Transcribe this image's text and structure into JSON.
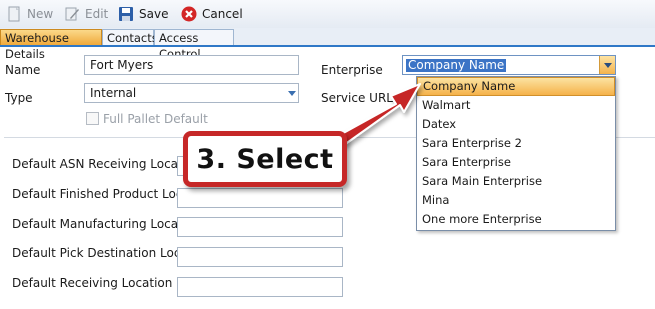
{
  "toolbar": {
    "new_label": "New",
    "edit_label": "Edit",
    "save_label": "Save",
    "cancel_label": "Cancel"
  },
  "tabs": [
    {
      "label": "Warehouse Details",
      "active": true
    },
    {
      "label": "Contacts",
      "active": false
    },
    {
      "label": "Access Control",
      "active": false
    }
  ],
  "form": {
    "name_label": "Name",
    "name_value": "Fort Myers",
    "type_label": "Type",
    "type_value": "Internal",
    "full_pallet_label": "Full Pallet Default",
    "enterprise_label": "Enterprise",
    "enterprise_value": "Company Name",
    "service_url_label": "Service URL"
  },
  "locations": [
    {
      "label": "Default ASN Receiving Location",
      "value": ""
    },
    {
      "label": "Default Finished Product Location",
      "value": ""
    },
    {
      "label": "Default Manufacturing Location",
      "value": ""
    },
    {
      "label": "Default Pick Destination Location",
      "value": ""
    },
    {
      "label": "Default Receiving Location",
      "value": ""
    }
  ],
  "enterprise_options": [
    "Company Name",
    "Walmart",
    "Datex",
    "Sara Enterprise  2",
    "Sara Enterprise",
    "Sara Main Enterprise",
    "Mina",
    "One more Enterprise"
  ],
  "selected_option_index": 0,
  "callout": {
    "text": "3. Select"
  },
  "colors": {
    "accent": "#2f78c7",
    "callout_red": "#c62828",
    "highlight": "#f5b24a"
  }
}
